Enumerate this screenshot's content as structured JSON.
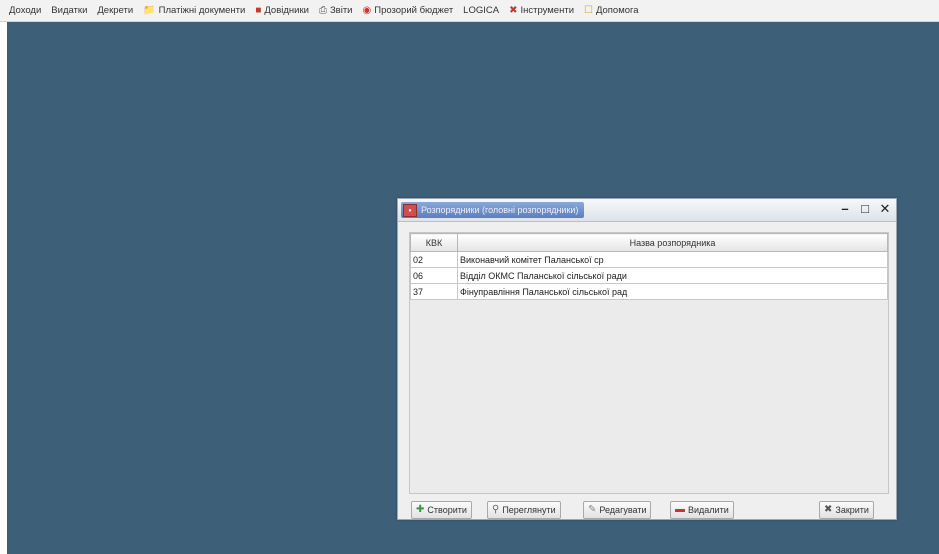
{
  "menubar": {
    "items": [
      {
        "label": "Доходи",
        "icon": ""
      },
      {
        "label": "Видатки",
        "icon": ""
      },
      {
        "label": "Декрети",
        "icon": ""
      },
      {
        "label": "Платіжні документи",
        "icon": "folder-icon"
      },
      {
        "label": "Довідники",
        "icon": "book-icon"
      },
      {
        "label": "Звіти",
        "icon": "printer-icon"
      },
      {
        "label": "Прозорий бюджет",
        "icon": "globe-icon"
      },
      {
        "label": "LOGICA",
        "icon": ""
      },
      {
        "label": "Інструменти",
        "icon": "tools-icon"
      },
      {
        "label": "Допомога",
        "icon": "help-icon"
      }
    ]
  },
  "window": {
    "title": "Розпорядники (головні розпорядники)",
    "columns": {
      "code": "КВК",
      "name": "Назва розпорядника"
    },
    "rows": [
      {
        "code": "02",
        "name": "Виконавчий комітет Паланської ср"
      },
      {
        "code": "06",
        "name": "Відділ ОКМС Паланської сільської ради"
      },
      {
        "code": "37",
        "name": "Фінуправління Паланської сільської рад"
      }
    ],
    "buttons": {
      "create": "Створити",
      "view": "Переглянути",
      "edit": "Редагувати",
      "delete": "Видалити",
      "close": "Закрити"
    }
  },
  "colors": {
    "desktop": "#3d5f78",
    "window": "#efefef"
  }
}
